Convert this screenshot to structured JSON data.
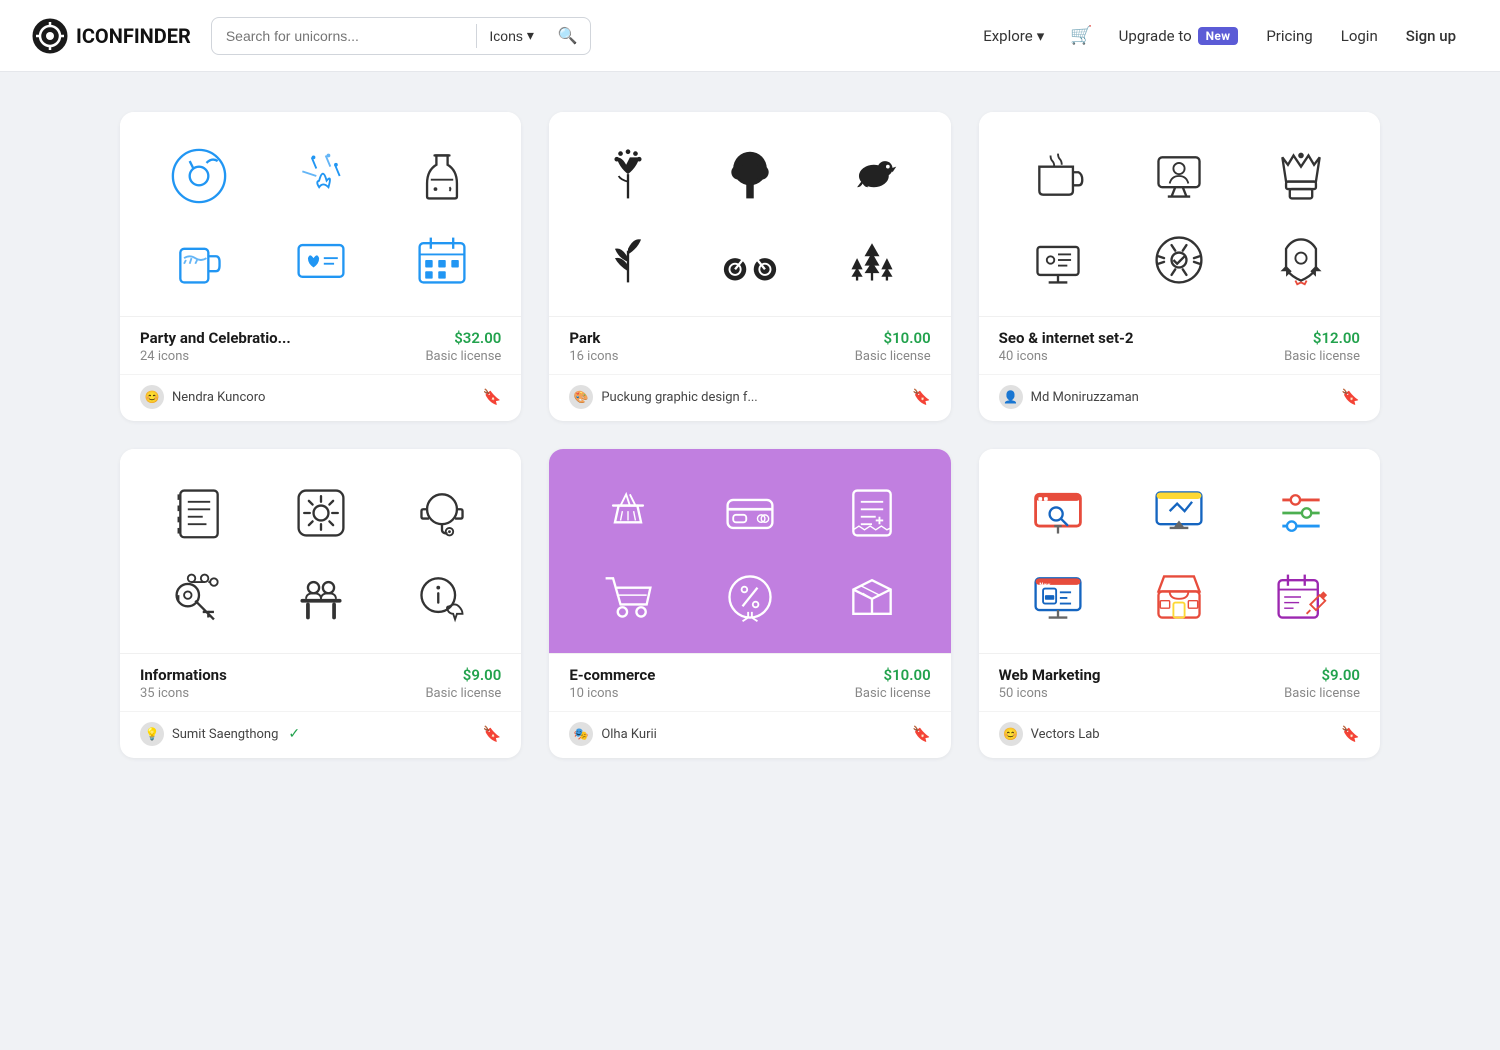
{
  "header": {
    "logo_text": "ICONFINDER",
    "search_placeholder": "Search for unicorns...",
    "search_type_label": "Icons",
    "explore_label": "Explore",
    "upgrade_label": "Upgrade to",
    "new_badge": "New",
    "pricing_label": "Pricing",
    "login_label": "Login",
    "signup_label": "Sign up"
  },
  "cards": [
    {
      "id": "party",
      "title": "Party and Celebratio...",
      "count": "24 icons",
      "price": "$32.00",
      "license": "Basic license",
      "author": "Nendra Kuncoro",
      "bg": "white",
      "icons": [
        "🎵",
        "✨",
        "🍾",
        "🍺",
        "💌",
        "📅"
      ]
    },
    {
      "id": "park",
      "title": "Park",
      "count": "16 icons",
      "price": "$10.00",
      "license": "Basic license",
      "author": "Puckung graphic design f...",
      "bg": "white",
      "icons": [
        "🌷",
        "🌳",
        "🐦",
        "🌿",
        "🚲",
        "🌲"
      ]
    },
    {
      "id": "seo",
      "title": "Seo & internet set-2",
      "count": "40 icons",
      "price": "$12.00",
      "license": "Basic license",
      "author": "Md Moniruzzaman",
      "bg": "white",
      "icons": [
        "☕",
        "💻",
        "👑",
        "📊",
        "⚙",
        "🚀"
      ]
    },
    {
      "id": "informations",
      "title": "Informations",
      "count": "35 icons",
      "price": "$9.00",
      "license": "Basic license",
      "author": "Sumit Saengthong",
      "verified": true,
      "bg": "white",
      "icons": [
        "📄",
        "⚙",
        "🎧",
        "🔧",
        "👥",
        "💬"
      ]
    },
    {
      "id": "ecommerce",
      "title": "E-commerce",
      "count": "10 icons",
      "price": "$10.00",
      "license": "Basic license",
      "author": "Olha Kurii",
      "bg": "purple",
      "icons": [
        "🛒",
        "💳",
        "🧾",
        "🛒",
        "🏷",
        "📦"
      ]
    },
    {
      "id": "webmarketing",
      "title": "Web Marketing",
      "count": "50 icons",
      "price": "$9.00",
      "license": "Basic license",
      "author": "Vectors Lab",
      "bg": "white",
      "icons": [
        "🔍",
        "🖥",
        "🎚",
        "🖥",
        "🏪",
        "📋"
      ]
    }
  ]
}
